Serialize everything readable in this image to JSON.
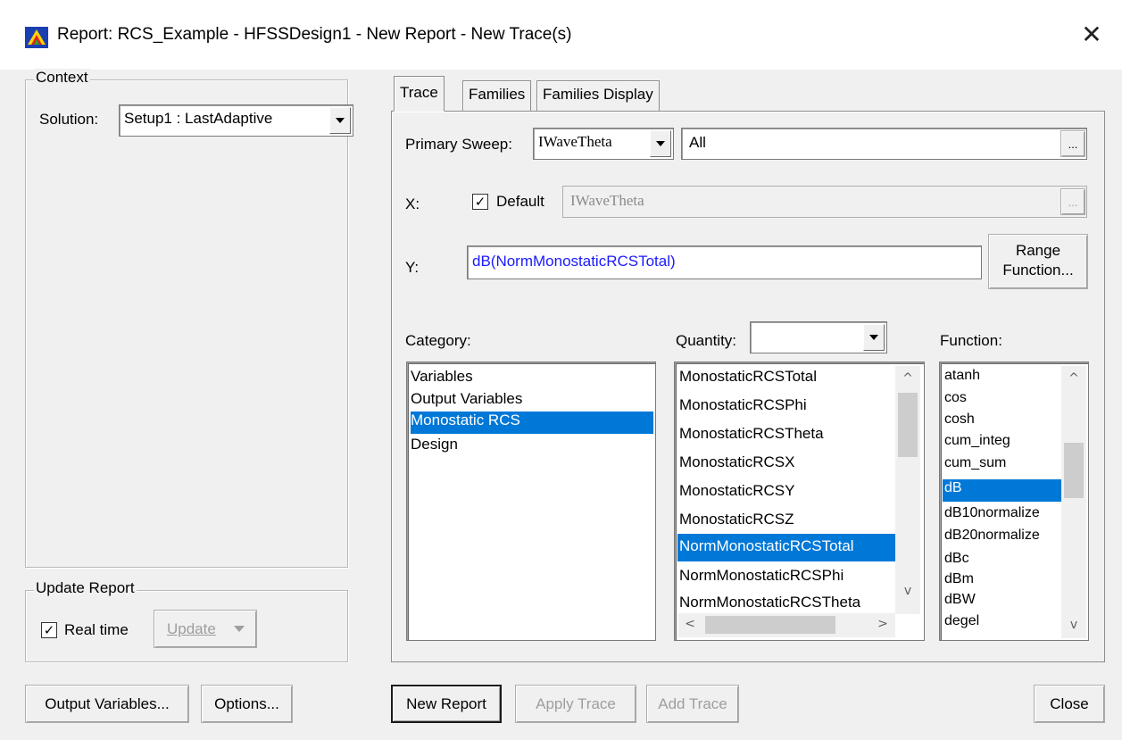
{
  "window": {
    "title": "Report: RCS_Example - HFSSDesign1 - New Report - New Trace(s)",
    "close_glyph": "✕"
  },
  "context": {
    "legend": "Context",
    "solution_label": "Solution:",
    "solution_value": "Setup1 : LastAdaptive"
  },
  "update_report": {
    "legend": "Update Report",
    "realtime_label": "Real time",
    "realtime_checked": true,
    "update_label": "Update"
  },
  "tabs": [
    {
      "label": "Trace",
      "active": true
    },
    {
      "label": "Families",
      "active": false
    },
    {
      "label": "Families Display",
      "active": false
    }
  ],
  "trace": {
    "primary_sweep_label": "Primary Sweep:",
    "primary_sweep_value": "IWaveTheta",
    "primary_sweep_range": "All",
    "ellipsis": "...",
    "x_label": "X:",
    "x_default_label": "Default",
    "x_default_checked": true,
    "x_value": "IWaveTheta",
    "y_label": "Y:",
    "y_value": "dB(NormMonostaticRCSTotal)",
    "y_color": "#1a1aff",
    "range_function_line1": "Range",
    "range_function_line2": "Function..."
  },
  "category": {
    "label": "Category:",
    "items": [
      "Variables",
      "Output Variables",
      "Monostatic RCS",
      "Design"
    ],
    "selected_index": 2
  },
  "quantity": {
    "label": "Quantity:",
    "filter_value": "",
    "items": [
      "MonostaticRCSTotal",
      "MonostaticRCSPhi",
      "MonostaticRCSTheta",
      "MonostaticRCSX",
      "MonostaticRCSY",
      "MonostaticRCSZ",
      "NormMonostaticRCSTotal",
      "NormMonostaticRCSPhi",
      "NormMonostaticRCSTheta"
    ],
    "selected_index": 6
  },
  "function": {
    "label": "Function:",
    "items": [
      "atanh",
      "cos",
      "cosh",
      "cum_integ",
      "cum_sum",
      "dB",
      "dB10normalize",
      "dB20normalize",
      "dBc",
      "dBm",
      "dBW",
      "degel"
    ],
    "selected_index": 5
  },
  "bottom": {
    "output_variables": "Output Variables...",
    "options": "Options...",
    "new_report": "New Report",
    "apply_trace": "Apply Trace",
    "add_trace": "Add Trace",
    "close": "Close"
  },
  "colors": {
    "selection": "#0078d7",
    "dialog_bg": "#f0f0f0"
  }
}
